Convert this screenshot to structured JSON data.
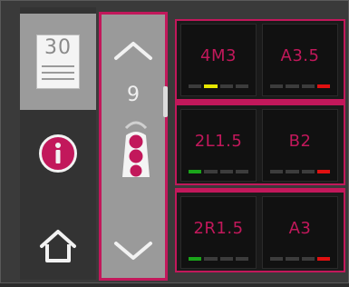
{
  "calendar": {
    "day": "30",
    "icon": "calendar-icon"
  },
  "info": {
    "icon": "info-icon",
    "color": "#c2185b"
  },
  "home": {
    "icon": "home-icon"
  },
  "selector": {
    "value": "9",
    "up_icon": "chevron-up-icon",
    "down_icon": "chevron-down-icon",
    "device_icon": "pendant-icon"
  },
  "colors": {
    "accent": "#c2185b",
    "yellow": "#e6e600",
    "green": "#1aa51a",
    "red": "#e01010",
    "off": "#3c3c3c"
  },
  "rows": [
    {
      "cells": [
        {
          "label": "4M3",
          "indicators": [
            "off",
            "yellow",
            "off",
            "off"
          ]
        },
        {
          "label": "A3.5",
          "indicators": [
            "off",
            "off",
            "off",
            "red"
          ]
        }
      ]
    },
    {
      "cells": [
        {
          "label": "2L1.5",
          "indicators": [
            "green",
            "off",
            "off",
            "off"
          ]
        },
        {
          "label": "B2",
          "indicators": [
            "off",
            "off",
            "off",
            "red"
          ]
        }
      ]
    },
    {
      "cells": [
        {
          "label": "2R1.5",
          "indicators": [
            "green",
            "off",
            "off",
            "off"
          ]
        },
        {
          "label": "A3",
          "indicators": [
            "off",
            "off",
            "off",
            "red"
          ]
        }
      ]
    }
  ]
}
